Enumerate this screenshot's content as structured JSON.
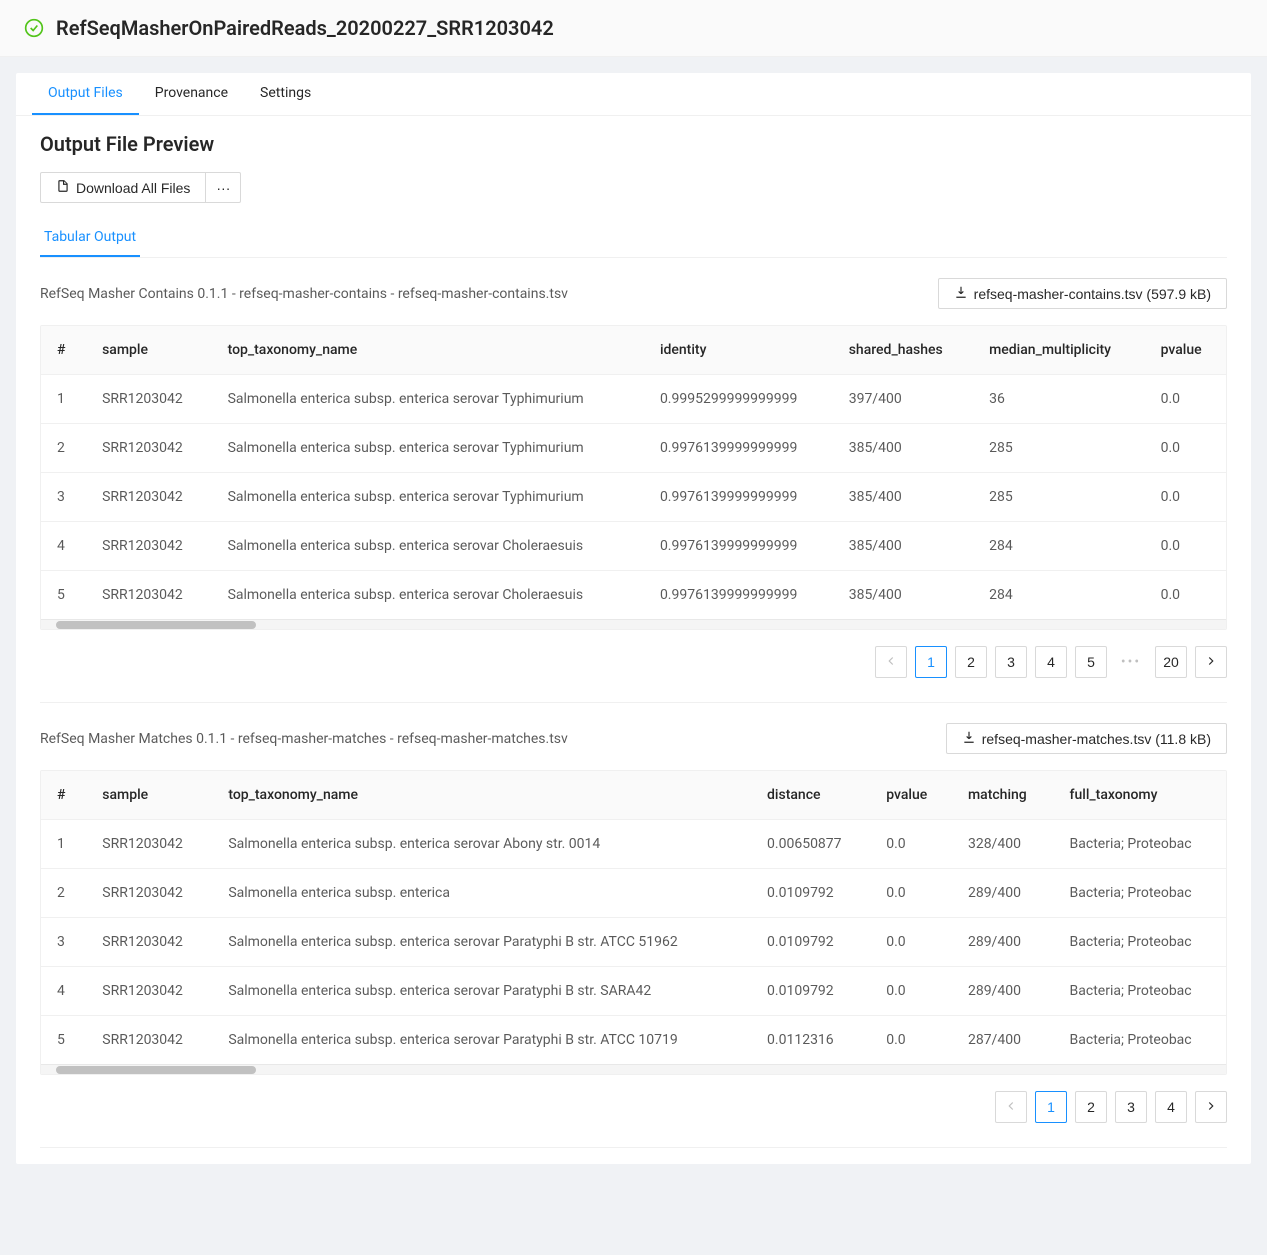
{
  "header": {
    "title": "RefSeqMasherOnPairedReads_20200227_SRR1203042"
  },
  "tabs": {
    "output_files": "Output Files",
    "provenance": "Provenance",
    "settings": "Settings"
  },
  "section": {
    "heading": "Output File Preview",
    "download_all": "Download All Files",
    "more": "···",
    "tabular_output": "Tabular Output"
  },
  "tables": {
    "contains": {
      "desc": "RefSeq Masher Contains 0.1.1 - refseq-masher-contains - refseq-masher-contains.tsv",
      "download": "refseq-masher-contains.tsv (597.9 kB)",
      "columns": [
        "#",
        "sample",
        "top_taxonomy_name",
        "identity",
        "shared_hashes",
        "median_multiplicity",
        "pvalue"
      ],
      "rows": [
        {
          "n": "1",
          "sample": "SRR1203042",
          "tax": "Salmonella enterica subsp. enterica serovar Typhimurium",
          "identity": "0.9995299999999999",
          "shared": "397/400",
          "median": "36",
          "pvalue": "0.0"
        },
        {
          "n": "2",
          "sample": "SRR1203042",
          "tax": "Salmonella enterica subsp. enterica serovar Typhimurium",
          "identity": "0.9976139999999999",
          "shared": "385/400",
          "median": "285",
          "pvalue": "0.0"
        },
        {
          "n": "3",
          "sample": "SRR1203042",
          "tax": "Salmonella enterica subsp. enterica serovar Typhimurium",
          "identity": "0.9976139999999999",
          "shared": "385/400",
          "median": "285",
          "pvalue": "0.0"
        },
        {
          "n": "4",
          "sample": "SRR1203042",
          "tax": "Salmonella enterica subsp. enterica serovar Choleraesuis",
          "identity": "0.9976139999999999",
          "shared": "385/400",
          "median": "284",
          "pvalue": "0.0"
        },
        {
          "n": "5",
          "sample": "SRR1203042",
          "tax": "Salmonella enterica subsp. enterica serovar Choleraesuis",
          "identity": "0.9976139999999999",
          "shared": "385/400",
          "median": "284",
          "pvalue": "0.0"
        }
      ],
      "pages": [
        "1",
        "2",
        "3",
        "4",
        "5",
        "20"
      ]
    },
    "matches": {
      "desc": "RefSeq Masher Matches 0.1.1 - refseq-masher-matches - refseq-masher-matches.tsv",
      "download": "refseq-masher-matches.tsv (11.8 kB)",
      "columns": [
        "#",
        "sample",
        "top_taxonomy_name",
        "distance",
        "pvalue",
        "matching",
        "full_taxonomy"
      ],
      "rows": [
        {
          "n": "1",
          "sample": "SRR1203042",
          "tax": "Salmonella enterica subsp. enterica serovar Abony str. 0014",
          "distance": "0.00650877",
          "pvalue": "0.0",
          "matching": "328/400",
          "full": "Bacteria; Proteobac"
        },
        {
          "n": "2",
          "sample": "SRR1203042",
          "tax": "Salmonella enterica subsp. enterica",
          "distance": "0.0109792",
          "pvalue": "0.0",
          "matching": "289/400",
          "full": "Bacteria; Proteobac"
        },
        {
          "n": "3",
          "sample": "SRR1203042",
          "tax": "Salmonella enterica subsp. enterica serovar Paratyphi B str. ATCC 51962",
          "distance": "0.0109792",
          "pvalue": "0.0",
          "matching": "289/400",
          "full": "Bacteria; Proteobac"
        },
        {
          "n": "4",
          "sample": "SRR1203042",
          "tax": "Salmonella enterica subsp. enterica serovar Paratyphi B str. SARA42",
          "distance": "0.0109792",
          "pvalue": "0.0",
          "matching": "289/400",
          "full": "Bacteria; Proteobac"
        },
        {
          "n": "5",
          "sample": "SRR1203042",
          "tax": "Salmonella enterica subsp. enterica serovar Paratyphi B str. ATCC 10719",
          "distance": "0.0112316",
          "pvalue": "0.0",
          "matching": "287/400",
          "full": "Bacteria; Proteobac"
        }
      ],
      "pages": [
        "1",
        "2",
        "3",
        "4"
      ]
    }
  }
}
